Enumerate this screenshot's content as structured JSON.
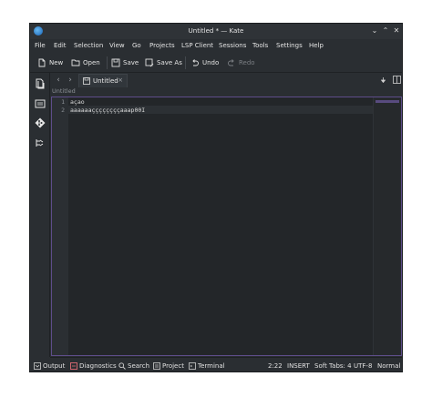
{
  "window": {
    "title": "Untitled * — Kate",
    "controls": {
      "shade": "⌄",
      "maximize": "⌃",
      "close": "✕"
    }
  },
  "menu": [
    "File",
    "Edit",
    "Selection",
    "View",
    "Go",
    "Projects",
    "LSP Client",
    "Sessions",
    "Tools",
    "Settings",
    "Help"
  ],
  "toolbar": {
    "new_label": "New",
    "open_label": "Open",
    "save_label": "Save",
    "save_as_label": "Save As",
    "undo_label": "Undo",
    "redo_label": "Redo"
  },
  "tabs": {
    "active_label": "Untitled",
    "close_glyph": "×",
    "back_glyph": "‹",
    "forward_glyph": "›",
    "split_glyph": "▯"
  },
  "breadcrumb": "Untitled",
  "editor": {
    "lines": [
      {
        "num": "1",
        "text": "açao"
      },
      {
        "num": "2",
        "text": "aaaaaaççççççççaaap00I"
      }
    ]
  },
  "statusbar": {
    "output": "Output",
    "diagnostics": "Diagnostics",
    "search": "Search",
    "project": "Project",
    "terminal": "Terminal",
    "cursor": "2:22",
    "mode": "INSERT",
    "indent": "Soft Tabs: 4",
    "encoding": "UTF-8",
    "input_mode": "Normal"
  },
  "colors": {
    "background": "#2a2e32",
    "editor": "#232629",
    "accent": "#5e4d8a",
    "text": "#e0e0e0"
  },
  "icons": [
    "kate-app-icon",
    "new-file-icon",
    "open-folder-icon",
    "save-icon",
    "save-as-icon",
    "undo-icon",
    "redo-icon",
    "documents-icon",
    "projects-icon",
    "git-icon",
    "symbols-icon",
    "file-tab-icon",
    "output-icon",
    "diagnostics-icon",
    "search-icon",
    "project-icon",
    "terminal-icon"
  ]
}
